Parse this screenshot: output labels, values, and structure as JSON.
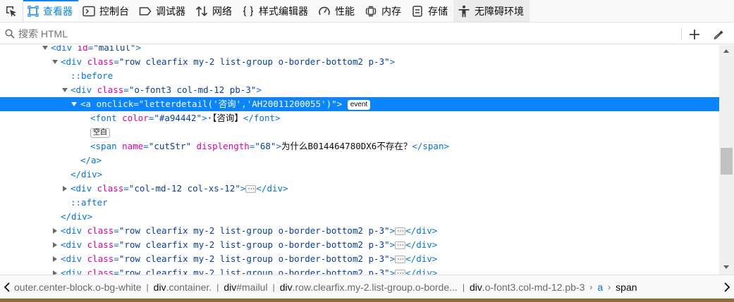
{
  "toolbar": {
    "tabs": [
      {
        "label": "查看器",
        "icon": "inspector-icon"
      },
      {
        "label": "控制台",
        "icon": "console-icon"
      },
      {
        "label": "调试器",
        "icon": "debugger-icon"
      },
      {
        "label": "网络",
        "icon": "network-icon"
      },
      {
        "label": "样式编辑器",
        "icon": "style-editor-icon"
      },
      {
        "label": "性能",
        "icon": "performance-icon"
      },
      {
        "label": "内存",
        "icon": "memory-icon"
      },
      {
        "label": "存储",
        "icon": "storage-icon"
      },
      {
        "label": "无障碍环境",
        "icon": "accessibility-icon"
      }
    ],
    "selected_tab": "查看器",
    "accent_color": "#0a84ff"
  },
  "search": {
    "placeholder": "搜索 HTML",
    "value": ""
  },
  "markup": {
    "l0_open": "<div ",
    "l0_attr": "id",
    "l0_val": "\"mailul\"",
    "l0_close": ">",
    "l1_open": "<div ",
    "l1_attr": "class",
    "l1_val": "\"row clearfix my-2 list-group o-border-bottom2 p-3\"",
    "l1_close": ">",
    "l2_pseudo": "::before",
    "l3_open": "<div ",
    "l3_attr": "class",
    "l3_val": "\"o-font3 col-md-12 pb-3\"",
    "l3_close": ">",
    "l4_open": "<a ",
    "l4_attr": "onclick",
    "l4_val": "\"letterdetail('咨询','AH20011200055')\"",
    "l4_close": ">",
    "l4_badge": "event",
    "l5_open": "<font ",
    "l5_attr": "color",
    "l5_val": "\"#a94442\"",
    "l5_gt": ">",
    "l5_text": "·【咨询】",
    "l5_close": "</font>",
    "l6_badge": "空白",
    "l7_open": "<span ",
    "l7_attr1": "name",
    "l7_val1": "\"cutStr\"",
    "l7_attr2": "displength",
    "l7_val2": "\"68\"",
    "l7_gt": ">",
    "l7_text": "为什么B014464780DX6不存在？",
    "l7_close": "</span>",
    "l8_close": "</a>",
    "l9_close": "</div>",
    "l10_open": "<div ",
    "l10_attr": "class",
    "l10_val": "\"col-md-12 col-xs-12\"",
    "l10_gt": ">",
    "l10_close": "</div>",
    "l11_pseudo": "::after",
    "l12_close": "</div>",
    "row_open": "<div ",
    "row_attr": "class",
    "row_val": "\"row clearfix my-2 list-group o-border-bottom2 p-3\"",
    "row_gt": ">",
    "row_close": "</div>",
    "ellipsis": "⋯"
  },
  "breadcrumbs": [
    {
      "tag": "",
      "extra": "outer.center-block.o-bg-white"
    },
    {
      "tag": "div",
      "extra": ".container."
    },
    {
      "tag": "div",
      "extra": "#mailul"
    },
    {
      "tag": "div",
      "extra": ".row.clearfix.my-2.list-group.o-borde..."
    },
    {
      "tag": "div",
      "extra": ".o-font3.col-md-12.pb-3"
    },
    {
      "tag": "a",
      "extra": ""
    },
    {
      "tag": "span",
      "extra": ""
    }
  ],
  "colors": {
    "selection": "#0a84ff",
    "tag": "#0074e8",
    "attr_name": "#dd00a9",
    "attr_value": "#003eaa"
  }
}
